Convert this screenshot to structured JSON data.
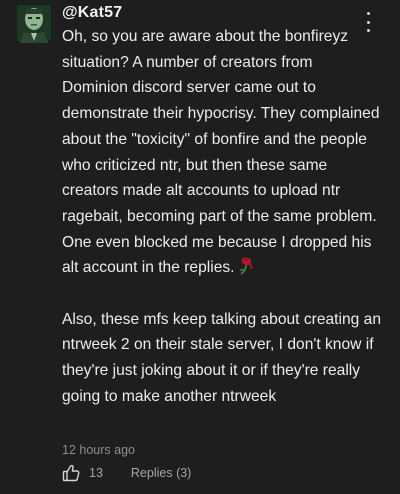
{
  "comment": {
    "avatar_icon": "avatar-green-portrait",
    "username": "@Kat57",
    "more_icon": "more-vertical-icon",
    "paragraph_1": "Oh, so you are aware about the bonfireyz situation? A number of creators from Dominion discord server came out to demonstrate their hypocrisy. They complained about the \"toxicity\" of bonfire and the people who criticized ntr, but then these same creators made alt accounts to upload ntr ragebait, becoming part of the same problem. One even blocked me because I dropped his alt account in the replies.",
    "paragraph_1_emoji": "wilted-rose-emoji",
    "paragraph_2": "Also, these mfs keep talking about creating an ntrweek 2 on their stale server, I don't know if they're just joking about it or if they're really going to make another ntrweek",
    "timestamp": "12 hours ago",
    "like_icon": "thumbs-up-icon",
    "like_count": "13",
    "replies_label": "Replies (3)"
  },
  "colors": {
    "background": "#1e1e1e",
    "text": "#ececec",
    "muted": "#8d8d8d"
  }
}
